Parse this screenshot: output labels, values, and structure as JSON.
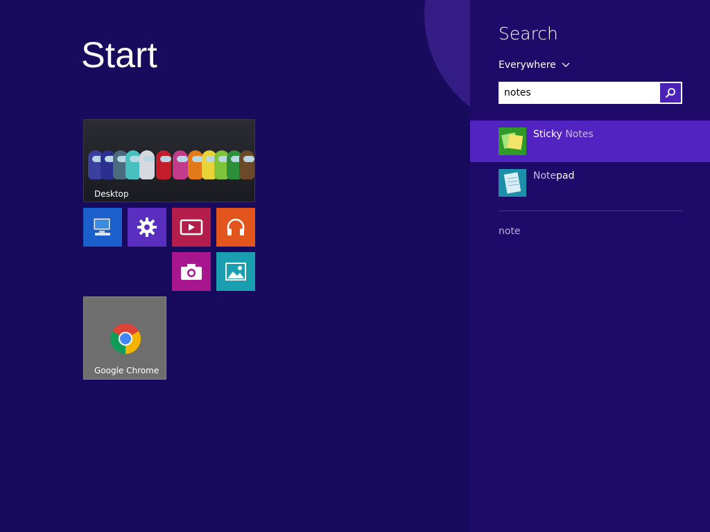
{
  "start": {
    "title": "Start",
    "tiles": {
      "desktop": {
        "label": "Desktop"
      },
      "chrome": {
        "label": "Google Chrome"
      }
    }
  },
  "search": {
    "title": "Search",
    "scope": "Everywhere",
    "query": "notes",
    "results": [
      {
        "label_prefix": "Sticky ",
        "label_match": "Notes",
        "selected": true
      },
      {
        "label_match": "Note",
        "label_suffix": "pad",
        "selected": false
      }
    ],
    "suggestion": "note"
  },
  "colors": {
    "background": "#180a5c",
    "pane": "#1e0b69",
    "selection": "#5223c0"
  }
}
